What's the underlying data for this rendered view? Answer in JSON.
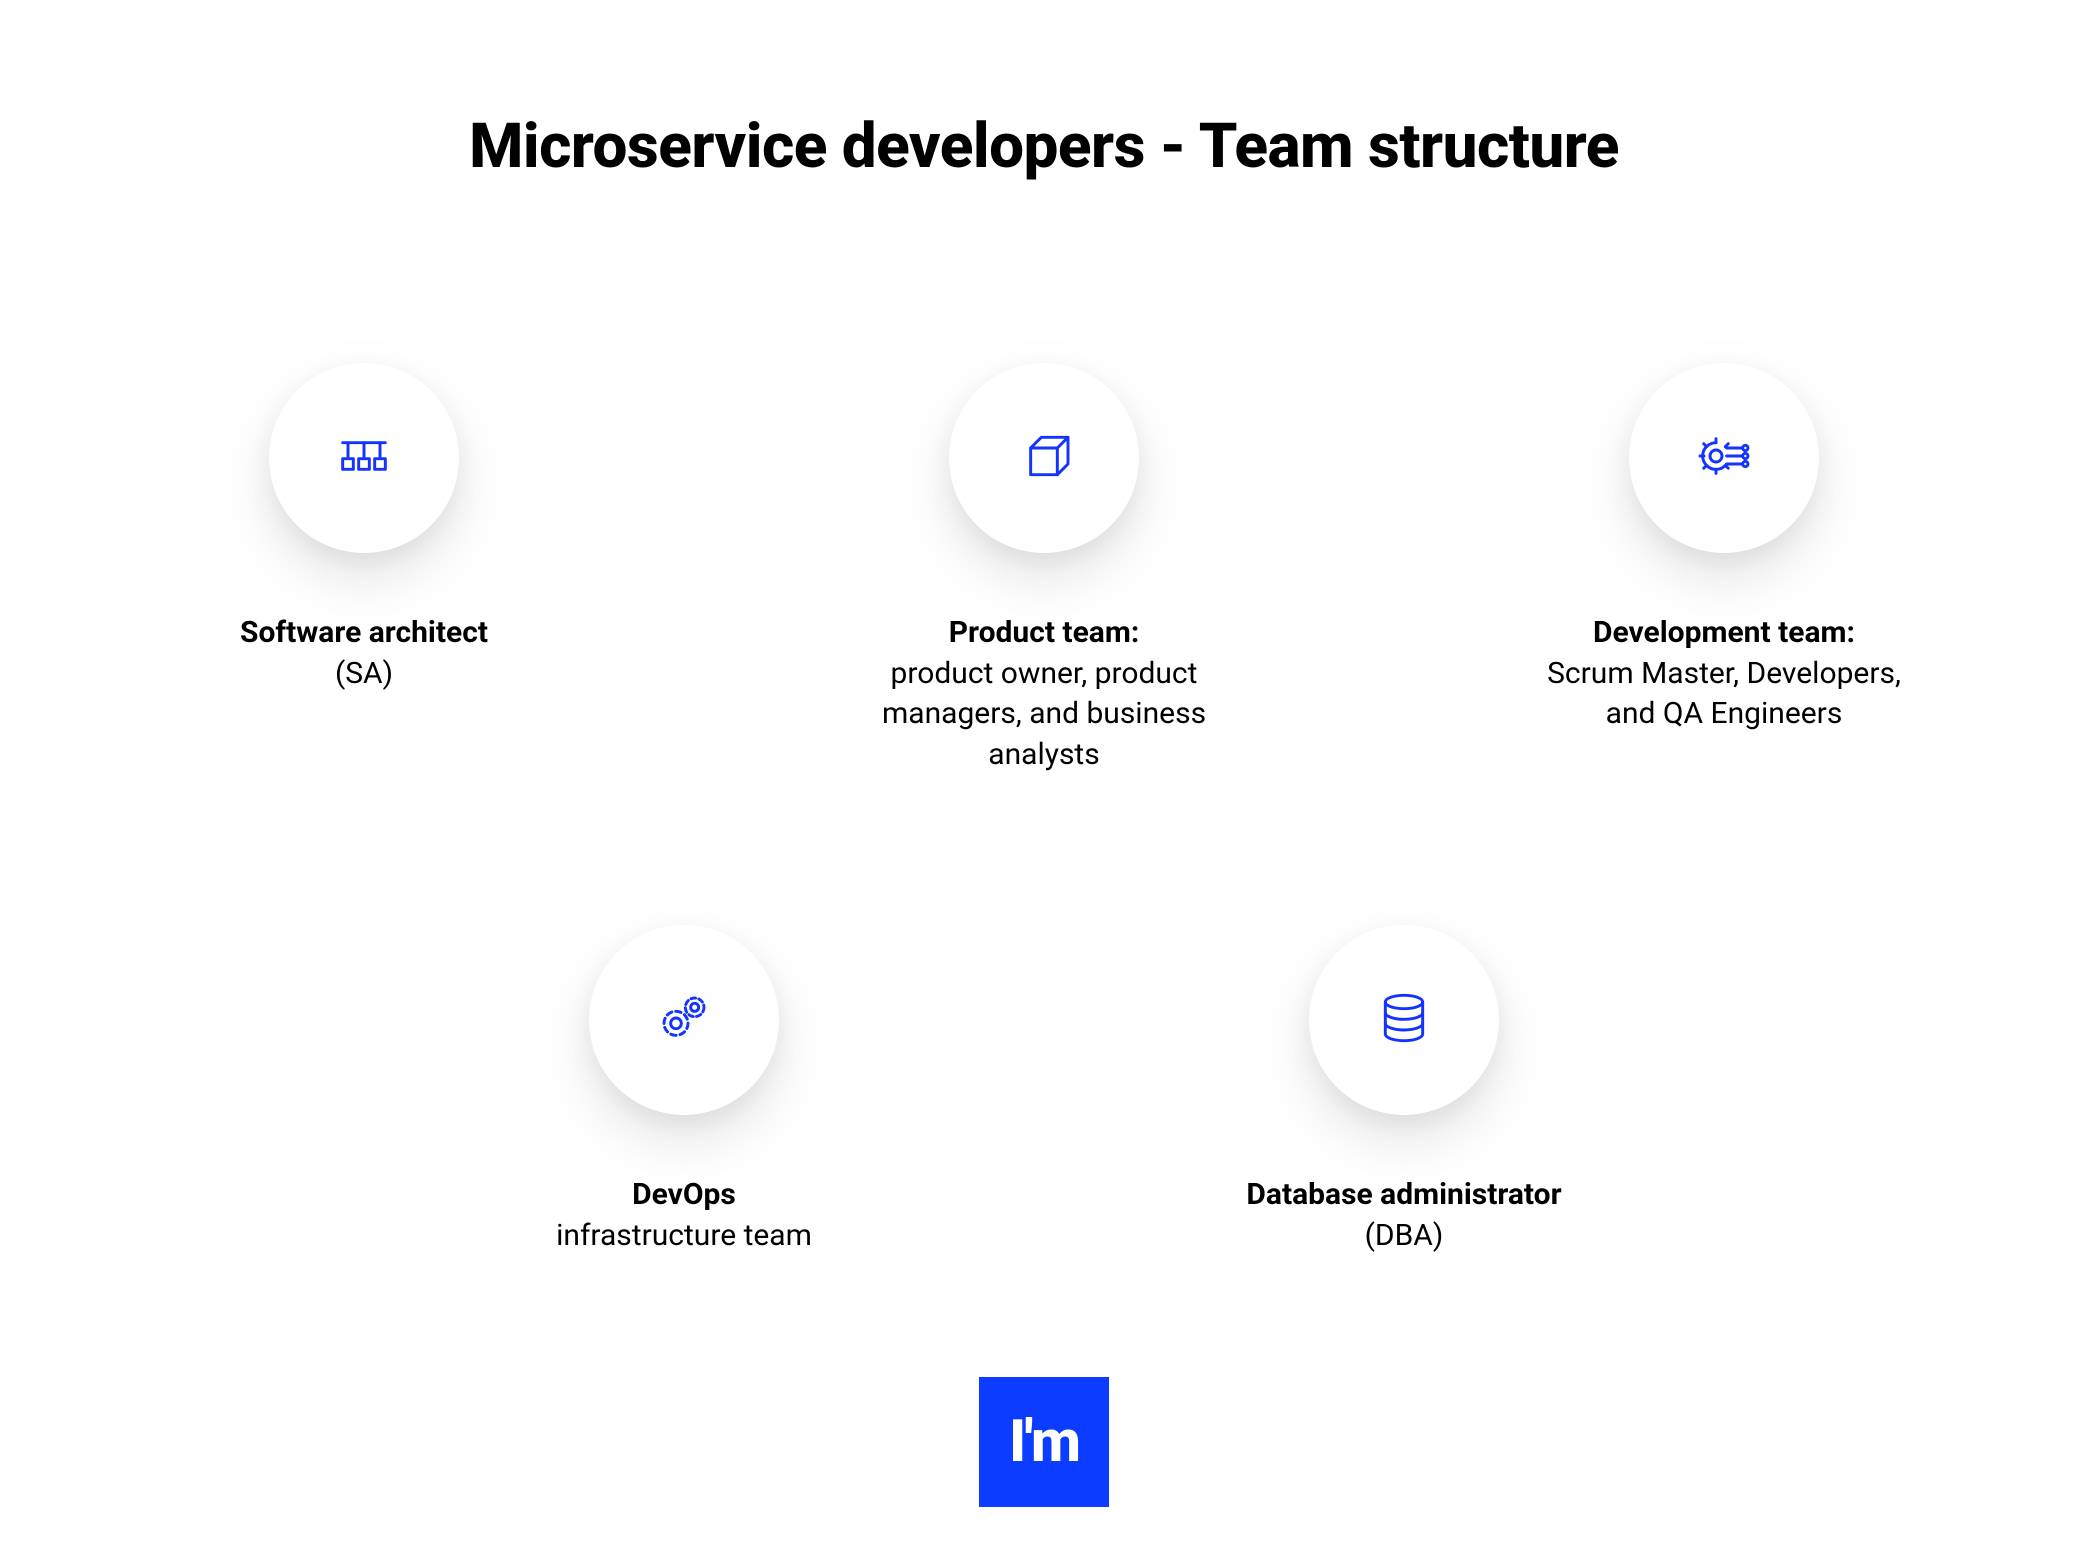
{
  "title": "Microservice developers - Team structure",
  "cards": {
    "sa": {
      "title": "Software architect",
      "sub": "(SA)"
    },
    "product": {
      "title": "Product team:",
      "sub": "product owner, product managers, and business analysts"
    },
    "dev": {
      "title": "Development team:",
      "sub": "Scrum Master, Developers, and QA Engineers"
    },
    "devops": {
      "title": "DevOps",
      "sub": "infrastructure team"
    },
    "dba": {
      "title": "Database administrator",
      "sub": "(DBA)"
    }
  },
  "brand": "I'm",
  "colors": {
    "accent": "#1533ff",
    "brand_bg": "#0b3cff"
  }
}
